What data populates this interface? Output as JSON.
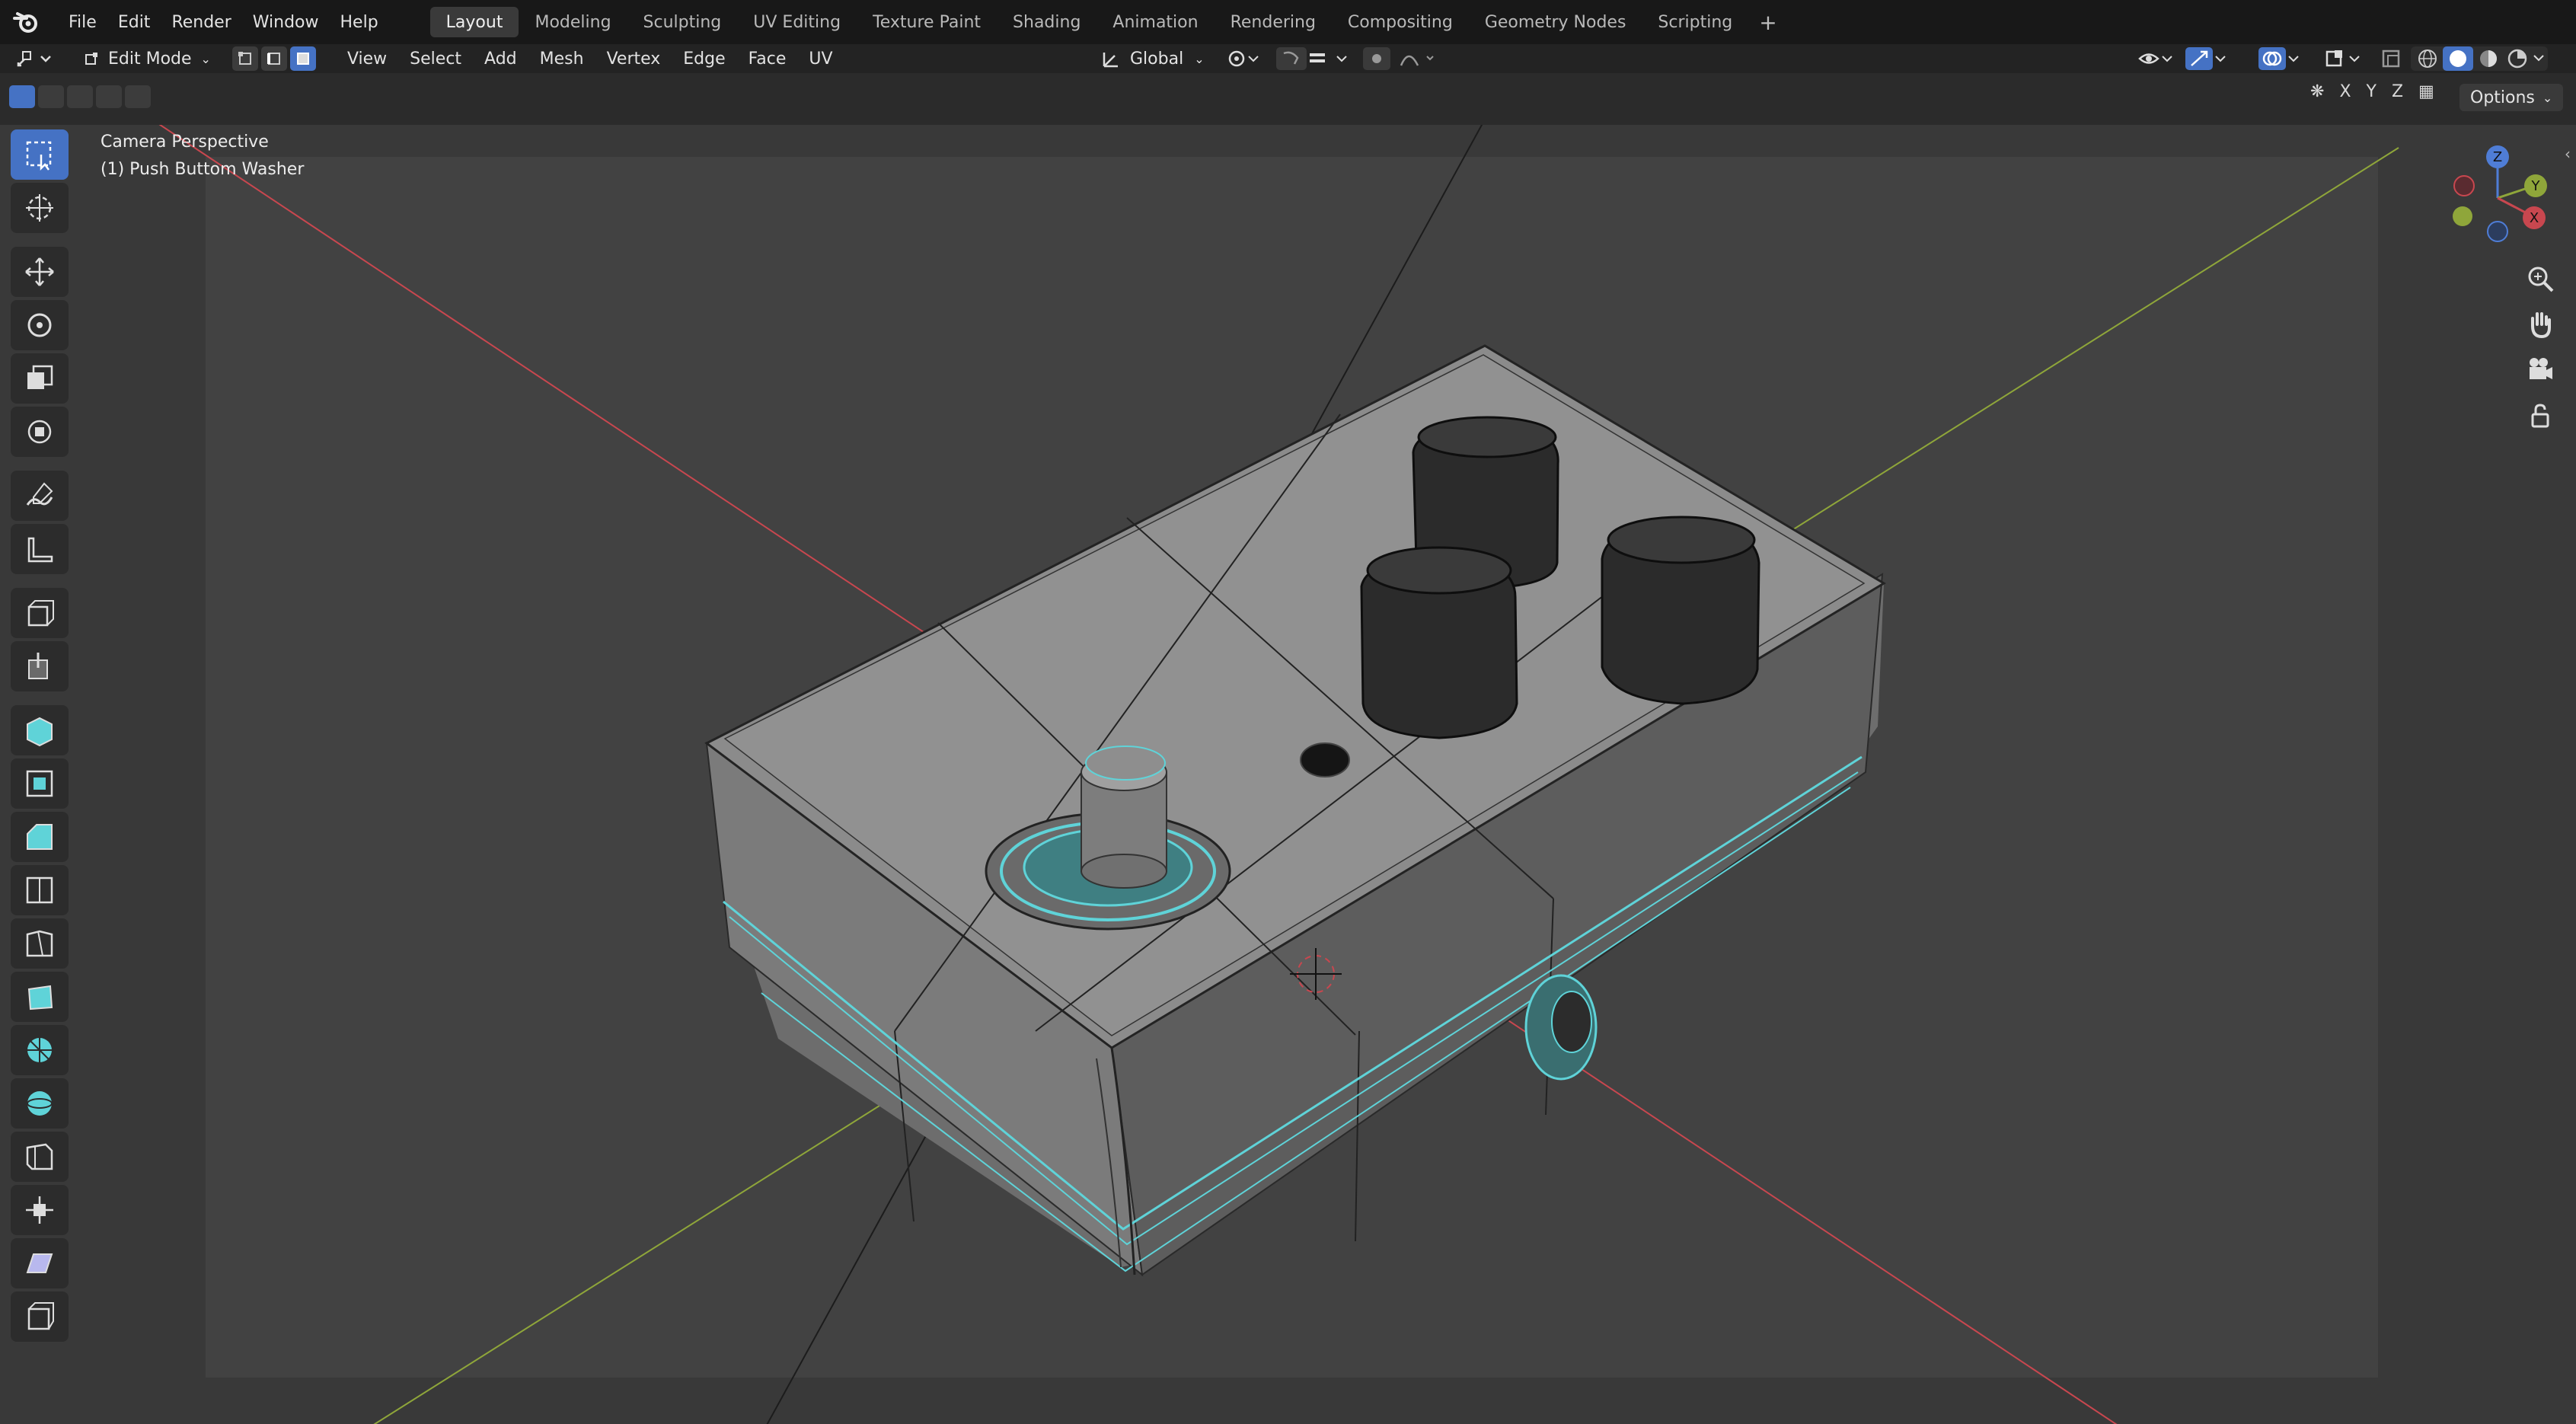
{
  "app": {
    "logo_icon": "blender-icon"
  },
  "menu": [
    {
      "label": "File"
    },
    {
      "label": "Edit"
    },
    {
      "label": "Render"
    },
    {
      "label": "Window"
    },
    {
      "label": "Help"
    }
  ],
  "workspaces": [
    {
      "label": "Layout",
      "active": true
    },
    {
      "label": "Modeling"
    },
    {
      "label": "Sculpting"
    },
    {
      "label": "UV Editing"
    },
    {
      "label": "Texture Paint"
    },
    {
      "label": "Shading"
    },
    {
      "label": "Animation"
    },
    {
      "label": "Rendering"
    },
    {
      "label": "Compositing"
    },
    {
      "label": "Geometry Nodes"
    },
    {
      "label": "Scripting"
    }
  ],
  "header": {
    "mode": "Edit Mode",
    "view_menus": [
      {
        "label": "View"
      },
      {
        "label": "Select"
      },
      {
        "label": "Add"
      },
      {
        "label": "Mesh"
      },
      {
        "label": "Vertex"
      },
      {
        "label": "Edge"
      },
      {
        "label": "Face"
      },
      {
        "label": "UV"
      }
    ],
    "orientation": "Global",
    "mirror_axes": [
      "X",
      "Y",
      "Z"
    ],
    "options_label": "Options"
  },
  "viewport": {
    "view_name": "Camera Perspective",
    "object_info": "(1) Push Buttom Washer",
    "gizmo": {
      "x": "X",
      "y": "Y",
      "z": "Z"
    },
    "colors": {
      "x_axis": "#c8474f",
      "y_axis": "#8fa63a",
      "selection": "#5fd3d8",
      "accent": "#4572c4"
    }
  },
  "tools": [
    "select-box-icon",
    "cursor-icon",
    "move-icon",
    "rotate-icon",
    "scale-icon",
    "transform-icon",
    "annotate-icon",
    "measure-icon",
    "add-cube-icon",
    "extrude-region-icon",
    "extrude-icon",
    "inset-faces-icon",
    "bevel-icon",
    "loop-cut-icon",
    "knife-icon",
    "poly-build-icon",
    "spin-icon",
    "smooth-icon",
    "edge-slide-icon",
    "shrink-fatten-icon",
    "shear-icon",
    "rip-region-icon"
  ]
}
